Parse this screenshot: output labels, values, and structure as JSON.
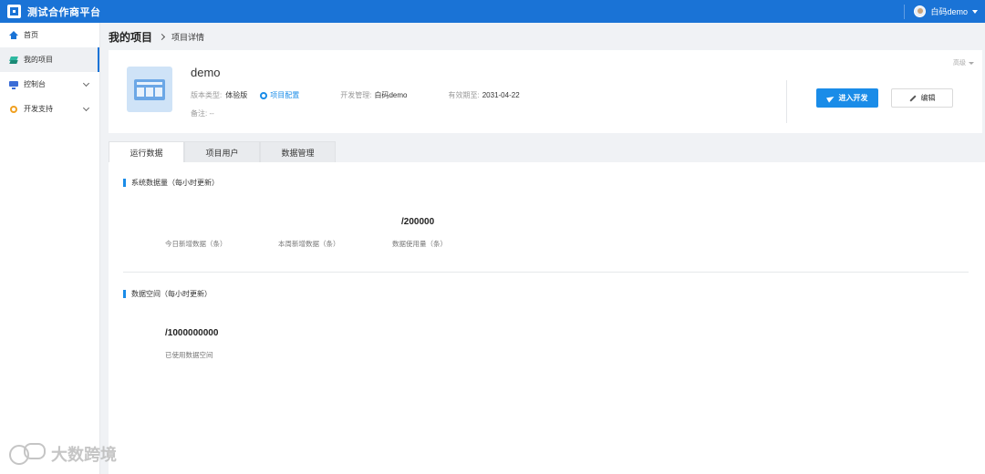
{
  "app": {
    "title": "测试合作商平台"
  },
  "user": {
    "name": "白码demo"
  },
  "sidebar": {
    "items": [
      {
        "label": "首页",
        "icon": "home-icon"
      },
      {
        "label": "我的项目",
        "icon": "layers-icon"
      },
      {
        "label": "控制台",
        "icon": "monitor-icon"
      },
      {
        "label": "开发支持",
        "icon": "gear-icon"
      }
    ]
  },
  "breadcrumb": {
    "root": "我的项目",
    "current": "项目详情"
  },
  "project": {
    "name": "demo",
    "version_label": "版本类型:",
    "version_value": "体验版",
    "config_link": "项目配置",
    "dev_manager_label": "开发管理:",
    "dev_manager_value": "白码demo",
    "expiry_label": "有效期至:",
    "expiry_value": "2031-04-22",
    "remark": "备注: --",
    "advanced": "高级",
    "enter_dev": "进入开发",
    "edit": "编辑"
  },
  "tabs": [
    {
      "label": "运行数据"
    },
    {
      "label": "项目用户"
    },
    {
      "label": "数据管理"
    }
  ],
  "data_stats": {
    "title": "系统数据量（每小时更新）",
    "today_label": "今日新增数据（条）",
    "week_label": "本周新增数据（条）",
    "usage_value": "/200000",
    "usage_label": "数据使用量（条）"
  },
  "space_stats": {
    "title": "数据空间（每小时更新）",
    "used_value": "/1000000000",
    "used_label": "已使用数据空间"
  },
  "watermark": "大数跨境",
  "colors": {
    "primary": "#1a73d6",
    "accent": "#1a8ce8"
  }
}
